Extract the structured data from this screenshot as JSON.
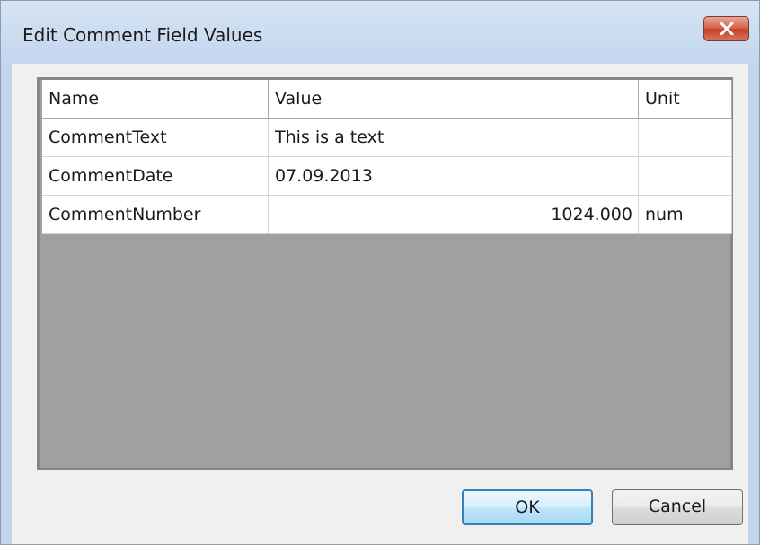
{
  "window": {
    "title": "Edit Comment Field Values",
    "close_icon": "close-icon"
  },
  "table": {
    "columns": [
      "Name",
      "Value",
      "Unit"
    ],
    "rows": [
      {
        "name": "CommentText",
        "value": "This is a text",
        "unit": ""
      },
      {
        "name": "CommentDate",
        "value": "07.09.2013",
        "unit": ""
      },
      {
        "name": "CommentNumber",
        "value": "1024.000",
        "unit": "num"
      }
    ]
  },
  "buttons": {
    "ok": "OK",
    "cancel": "Cancel"
  },
  "colors": {
    "titlebar": "#c3d6ee",
    "grid_empty": "#a0a0a0",
    "close_button": "#c4412a",
    "ok_border": "#3c7fb1"
  }
}
